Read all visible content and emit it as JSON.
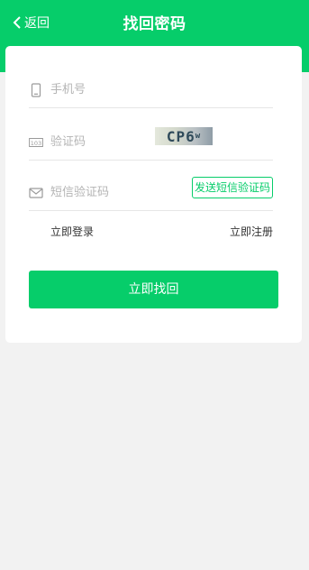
{
  "header": {
    "back_label": "返回",
    "title": "找回密码",
    "color": "#06cd6a"
  },
  "form": {
    "phone": {
      "placeholder": "手机号",
      "icon": "phone-icon"
    },
    "captcha": {
      "placeholder": "验证码",
      "icon": "captcha-icon",
      "image_text": "CP6",
      "image_text_small": "w"
    },
    "sms": {
      "placeholder": "短信验证码",
      "icon": "mail-icon",
      "send_label": "发送短信验证码"
    }
  },
  "links": {
    "login": "立即登录",
    "register": "立即注册"
  },
  "submit_label": "立即找回"
}
